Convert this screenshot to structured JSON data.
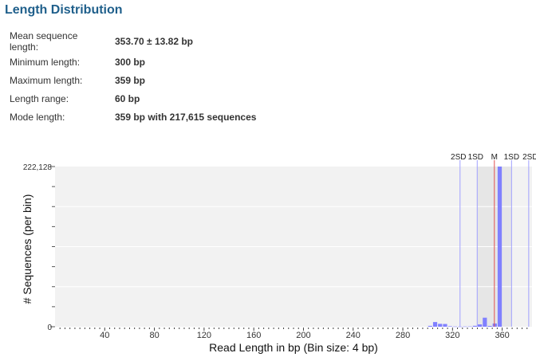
{
  "page": {
    "title": "Length Distribution",
    "stats": [
      {
        "label": "Mean sequence length:",
        "value": "353.70 ± 13.82 bp"
      },
      {
        "label": "Minimum length:",
        "value": "300 bp"
      },
      {
        "label": "Maximum length:",
        "value": "359 bp"
      },
      {
        "label": "Length range:",
        "value": "60 bp"
      },
      {
        "label": "Mode length:",
        "value": "359 bp with 217,615 sequences"
      }
    ]
  },
  "colors": {
    "bar": "#8080ff",
    "mean_line": "#e05050",
    "sd_line": "#a0a0ff",
    "panel": "#f2f2f2",
    "sd_band": "#e6e6e6",
    "title": "#1f5f8b"
  },
  "chart_data": {
    "type": "bar",
    "xlabel": "Read Length in bp (Bin size: 4 bp)",
    "ylabel": "# Sequences (per bin)",
    "xlim": [
      0,
      384
    ],
    "ylim": [
      0,
      222128
    ],
    "bin_size": 4,
    "xticks": [
      40,
      80,
      120,
      160,
      200,
      240,
      280,
      320,
      360
    ],
    "yticks": [
      0,
      222128
    ],
    "ytick_labels": [
      "0",
      "222,128"
    ],
    "grid": true,
    "bins": [
      {
        "x": 300,
        "y": 1200
      },
      {
        "x": 304,
        "y": 6500
      },
      {
        "x": 308,
        "y": 4000
      },
      {
        "x": 312,
        "y": 3800
      },
      {
        "x": 316,
        "y": 700
      },
      {
        "x": 320,
        "y": 300
      },
      {
        "x": 324,
        "y": 200
      },
      {
        "x": 328,
        "y": 300
      },
      {
        "x": 332,
        "y": 400
      },
      {
        "x": 336,
        "y": 1300
      },
      {
        "x": 340,
        "y": 3200
      },
      {
        "x": 344,
        "y": 12500
      },
      {
        "x": 348,
        "y": 1100
      },
      {
        "x": 352,
        "y": 4500
      },
      {
        "x": 356,
        "y": 222128
      }
    ],
    "mean": 353.7,
    "sd": 13.82,
    "markers": [
      {
        "label": "2SD",
        "x": 326.06
      },
      {
        "label": "1SD",
        "x": 339.88
      },
      {
        "label": "M",
        "x": 353.7
      },
      {
        "label": "1SD",
        "x": 367.52
      },
      {
        "label": "2SD",
        "x": 381.34
      }
    ]
  }
}
